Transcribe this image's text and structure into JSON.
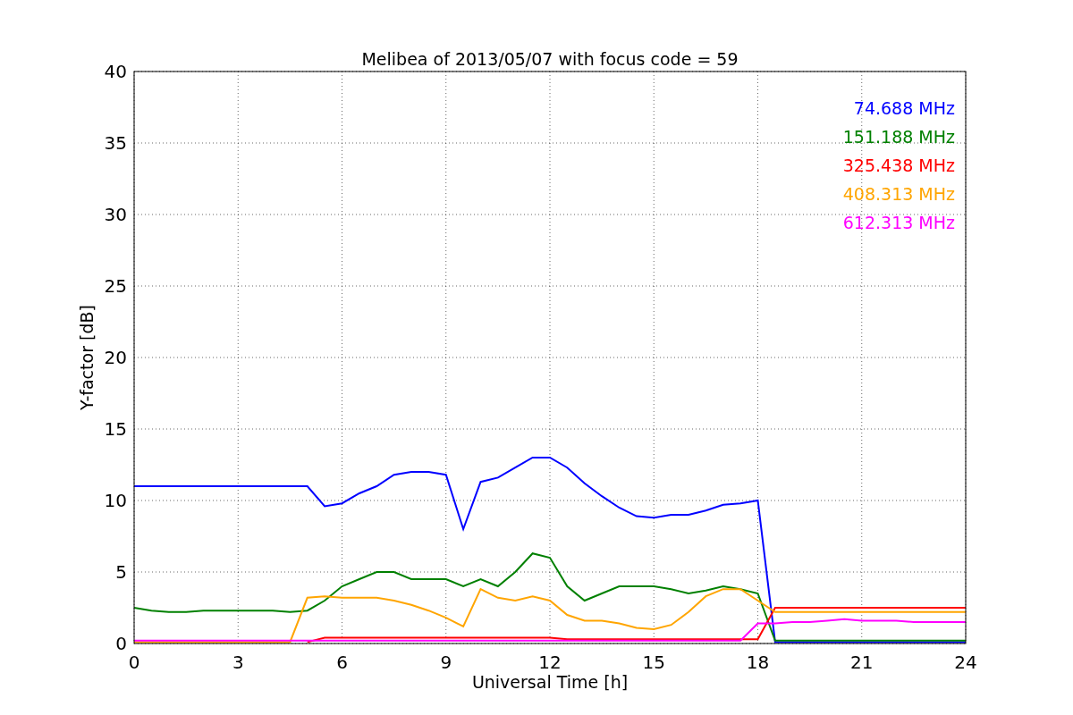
{
  "figure": {
    "chart_data": {
      "type": "line",
      "title": "Melibea of 2013/05/07 with focus code = 59",
      "xlabel": "Universal Time [h]",
      "ylabel": "Y-factor [dB]",
      "x": [
        0,
        0.5,
        1,
        1.5,
        2,
        2.5,
        3,
        3.5,
        4,
        4.5,
        5,
        5.5,
        6,
        6.5,
        7,
        7.5,
        8,
        8.5,
        9,
        9.5,
        10,
        10.5,
        11,
        11.5,
        12,
        12.5,
        13,
        13.5,
        14,
        14.5,
        15,
        15.5,
        16,
        16.5,
        17,
        17.5,
        18,
        18.5,
        19,
        19.5,
        20,
        20.5,
        21,
        21.5,
        22,
        22.5,
        23,
        23.5,
        24
      ],
      "series": [
        {
          "name": "74.688 MHz",
          "color": "#0000ff",
          "values": [
            11,
            11,
            11,
            11,
            11,
            11,
            11,
            11,
            11,
            11,
            11,
            9.6,
            9.8,
            10.5,
            11,
            11.8,
            12,
            12,
            11.8,
            8,
            11.3,
            11.6,
            12.3,
            13,
            13,
            12.3,
            11.2,
            10.3,
            9.5,
            8.9,
            8.8,
            9,
            9,
            9.3,
            9.7,
            9.8,
            10,
            0.1,
            0.1,
            0.1,
            0.1,
            0.1,
            0.1,
            0.1,
            0.1,
            0.1,
            0.1,
            0.1,
            0.1
          ]
        },
        {
          "name": "151.188 MHz",
          "color": "#008000",
          "values": [
            2.5,
            2.3,
            2.2,
            2.2,
            2.3,
            2.3,
            2.3,
            2.3,
            2.3,
            2.2,
            2.3,
            3,
            4,
            4.5,
            5,
            5,
            4.5,
            4.5,
            4.5,
            4,
            4.5,
            4,
            5,
            6.3,
            6,
            4,
            3,
            3.5,
            4,
            4,
            4,
            3.8,
            3.5,
            3.7,
            4,
            3.8,
            3.5,
            0.2,
            0.2,
            0.2,
            0.2,
            0.2,
            0.2,
            0.2,
            0.2,
            0.2,
            0.2,
            0.2,
            0.2
          ]
        },
        {
          "name": "325.438 MHz",
          "color": "#ff0000",
          "values": [
            null,
            null,
            null,
            null,
            null,
            null,
            null,
            null,
            null,
            null,
            0.1,
            0.4,
            0.4,
            0.4,
            0.4,
            0.4,
            0.4,
            0.4,
            0.4,
            0.4,
            0.4,
            0.4,
            0.4,
            0.4,
            0.4,
            0.3,
            0.3,
            0.3,
            0.3,
            0.3,
            0.3,
            0.3,
            0.3,
            0.3,
            0.3,
            0.3,
            0.3,
            2.5,
            2.5,
            2.5,
            2.5,
            2.5,
            2.5,
            2.5,
            2.5,
            2.5,
            2.5,
            2.5,
            2.5
          ]
        },
        {
          "name": "408.313 MHz",
          "color": "#ffa500",
          "values": [
            0.1,
            0.1,
            0.1,
            0.1,
            0.1,
            0.1,
            0.1,
            0.1,
            0.1,
            0.1,
            3.2,
            3.3,
            3.2,
            3.2,
            3.2,
            3,
            2.7,
            2.3,
            1.8,
            1.2,
            3.8,
            3.2,
            3,
            3.3,
            3,
            2,
            1.6,
            1.6,
            1.4,
            1.1,
            1,
            1.3,
            2.2,
            3.3,
            3.8,
            3.8,
            3,
            2.2,
            2.2,
            2.2,
            2.2,
            2.2,
            2.2,
            2.2,
            2.2,
            2.2,
            2.2,
            2.2,
            2.2
          ]
        },
        {
          "name": "612.313 MHz",
          "color": "#ff00ff",
          "values": [
            0.2,
            0.2,
            0.2,
            0.2,
            0.2,
            0.2,
            0.2,
            0.2,
            0.2,
            0.2,
            0.2,
            0.2,
            0.2,
            0.2,
            0.2,
            0.2,
            0.2,
            0.2,
            0.2,
            0.2,
            0.2,
            0.2,
            0.2,
            0.2,
            0.2,
            0.2,
            0.2,
            0.2,
            0.2,
            0.2,
            0.2,
            0.2,
            0.2,
            0.2,
            0.2,
            0.2,
            1.4,
            1.4,
            1.5,
            1.5,
            1.6,
            1.7,
            1.6,
            1.6,
            1.6,
            1.5,
            1.5,
            1.5,
            1.5
          ]
        }
      ],
      "grid": true,
      "xlim": [
        0,
        24
      ],
      "ylim": [
        0,
        40
      ],
      "xticks": [
        0,
        3,
        6,
        9,
        12,
        15,
        18,
        21,
        24
      ],
      "yticks": [
        0,
        5,
        10,
        15,
        20,
        25,
        30,
        35,
        40
      ]
    }
  }
}
